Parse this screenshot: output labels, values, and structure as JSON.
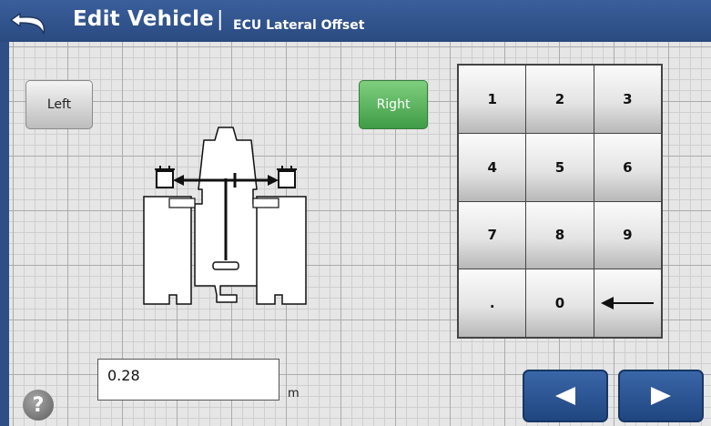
{
  "header": {
    "title": "Edit Vehicle",
    "separator": "|",
    "subtitle": "ECU Lateral Offset",
    "back_icon": "back-arrow-icon"
  },
  "direction": {
    "left_label": "Left",
    "right_label": "Right",
    "selected": "Right",
    "selected_color": "#4caf50"
  },
  "keypad": {
    "keys": [
      "1",
      "2",
      "3",
      "4",
      "5",
      "6",
      "7",
      "8",
      "9",
      ".",
      "0",
      "backspace"
    ]
  },
  "offset": {
    "value": "0.28",
    "unit": "m"
  },
  "nav": {
    "prev_icon": "triangle-left-icon",
    "next_icon": "triangle-right-icon"
  },
  "help": {
    "label": "?"
  },
  "colors": {
    "titlebar": "#2e4f86",
    "nav_button": "#2a5494",
    "grid_background": "#e6e6e6"
  }
}
